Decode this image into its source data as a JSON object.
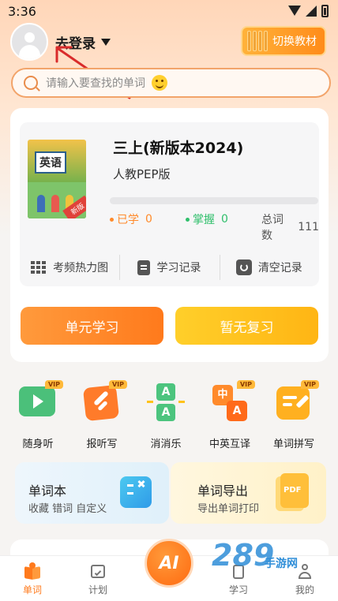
{
  "status_bar": {
    "time": "3:36"
  },
  "header": {
    "login_label": "去登录",
    "switch_button": "切换教材"
  },
  "search": {
    "placeholder": "请输入要查找的单词"
  },
  "book": {
    "cover_label": "英语",
    "cover_badge": "新版",
    "title": "三上(新版本2024)",
    "publisher": "人教PEP版",
    "progress_fraction": 0,
    "learned_label": "已学",
    "learned_value": "0",
    "mastered_label": "掌握",
    "mastered_value": "0",
    "total_label": "总词数",
    "total_value": "111"
  },
  "tools": [
    {
      "label": "考频热力图",
      "icon": "grid-icon"
    },
    {
      "label": "学习记录",
      "icon": "document-icon"
    },
    {
      "label": "清空记录",
      "icon": "refresh-icon"
    }
  ],
  "actions": {
    "unit_study": "单元学习",
    "review": "暂无复习"
  },
  "features": [
    {
      "label": "随身听",
      "vip": "VIP",
      "icon": "play-icon"
    },
    {
      "label": "报听写",
      "vip": "VIP",
      "icon": "pen-icon"
    },
    {
      "label": "消消乐",
      "vip": "",
      "icon": "letter-blocks-icon"
    },
    {
      "label": "中英互译",
      "vip": "VIP",
      "icon": "translate-icon"
    },
    {
      "label": "单词拼写",
      "vip": "VIP",
      "icon": "spelling-icon"
    }
  ],
  "promos": {
    "wordbook_title": "单词本",
    "wordbook_sub": "收藏 错词 自定义",
    "export_title": "单词导出",
    "export_sub": "导出单词打印",
    "export_badge": "PDF"
  },
  "nav": {
    "words": "单词",
    "plan": "计划",
    "ai": "AI",
    "study": "学习",
    "mine": "我的"
  },
  "watermark": {
    "main": "289",
    "sub": "手游网"
  },
  "colors": {
    "accent": "#ff8a2b",
    "learned_dot": "#ff8a2b",
    "mastered_dot": "#2fbf6b",
    "review_btn": "#ffc21a"
  }
}
